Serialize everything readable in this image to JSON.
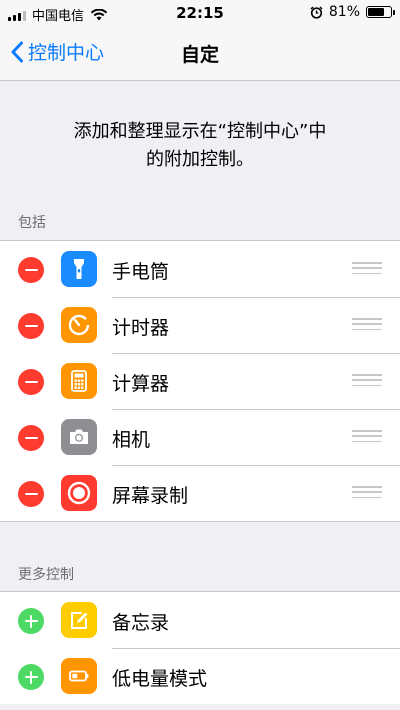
{
  "status_bar": {
    "carrier": "中国电信",
    "time": "22:15",
    "battery": "81%",
    "battery_level": 0.81,
    "icons": [
      "signal-icon",
      "wifi-icon",
      "alarm-icon",
      "battery-icon"
    ]
  },
  "nav": {
    "back_label": "控制中心",
    "title": "自定"
  },
  "description": {
    "line1": "添加和整理显示在“控制中心”中",
    "line2": "的附加控制。"
  },
  "included": {
    "header": "包括",
    "items": [
      {
        "label": "手电筒",
        "icon": "flashlight-icon",
        "color": "#1a8cff"
      },
      {
        "label": "计时器",
        "icon": "timer-icon",
        "color": "#ff9500"
      },
      {
        "label": "计算器",
        "icon": "calculator-icon",
        "color": "#ff9500"
      },
      {
        "label": "相机",
        "icon": "camera-icon",
        "color": "#8e8e93"
      },
      {
        "label": "屏幕录制",
        "icon": "screen-record-icon",
        "color": "#ff3b30"
      }
    ]
  },
  "more": {
    "header": "更多控制",
    "items": [
      {
        "label": "备忘录",
        "icon": "notes-icon",
        "color": "#ffcc00"
      },
      {
        "label": "低电量模式",
        "icon": "low-power-icon",
        "color": "#ff9500"
      }
    ]
  },
  "colors": {
    "accent": "#0a7aff",
    "remove": "#ff3b30",
    "add": "#4cd964"
  }
}
